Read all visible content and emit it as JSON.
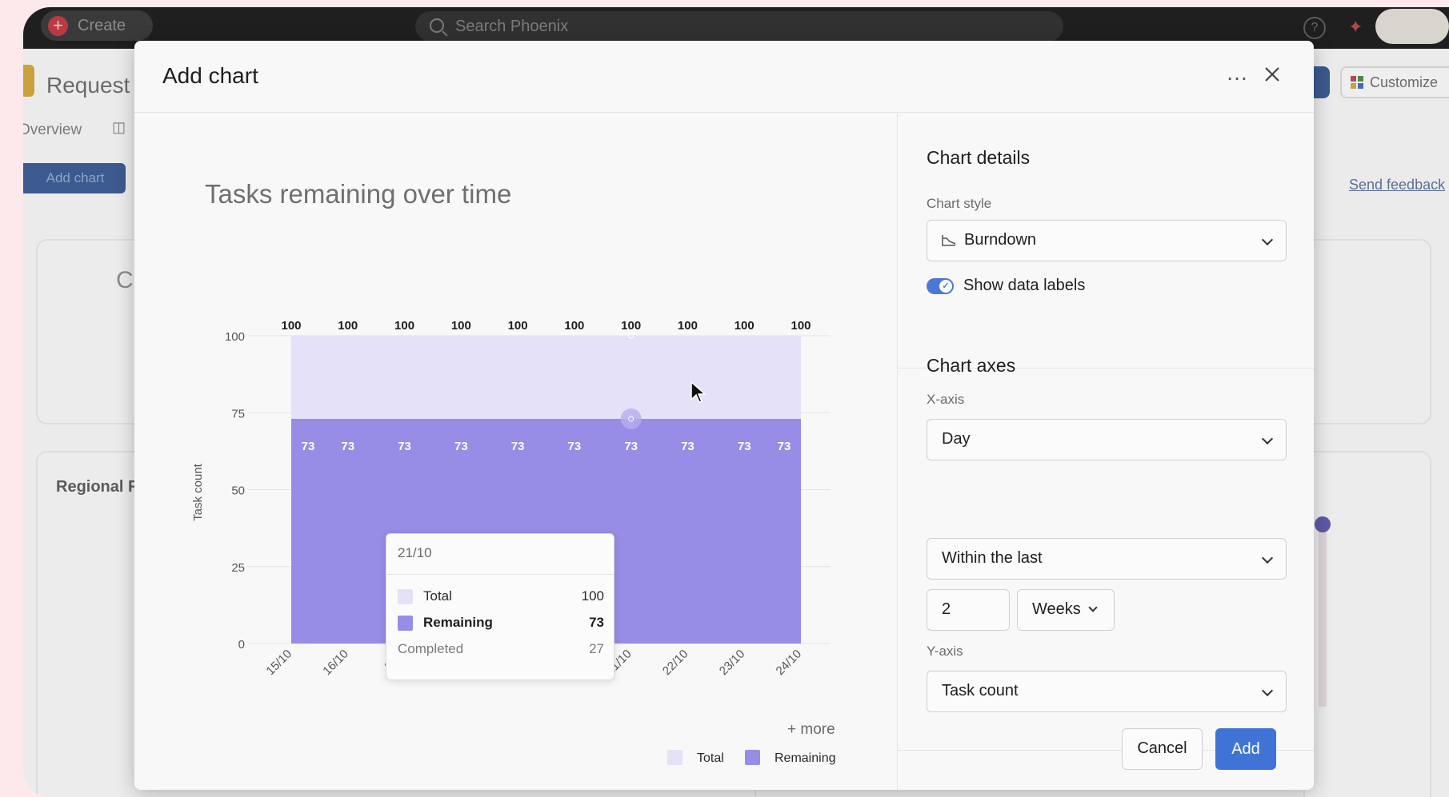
{
  "topbar": {
    "create_label": "Create",
    "search_placeholder": "Search Phoenix",
    "help_label": "?"
  },
  "project": {
    "title": "Request",
    "tab_overview": "Overview",
    "add_chart_label": "Add chart",
    "customize_label": "Customize",
    "send_feedback_label": "Send feedback",
    "card_letter": "C",
    "card_regional": "Regional R"
  },
  "modal": {
    "title": "Add chart",
    "more_label": "…",
    "chart": {
      "title": "Tasks remaining over time",
      "more_link": "+ more"
    },
    "tooltip": {
      "date": "21/10",
      "rows": [
        {
          "label": "Total",
          "value": "100",
          "color": "#e4e1f8"
        },
        {
          "label": "Remaining",
          "value": "73",
          "color": "#978ce6"
        },
        {
          "label": "Completed",
          "value": "27"
        }
      ]
    },
    "settings": {
      "chart_details_title": "Chart details",
      "chart_style_label": "Chart style",
      "chart_style_value": "Burndown",
      "show_data_labels": "Show data labels",
      "show_data_labels_on": true,
      "chart_axes_title": "Chart axes",
      "x_axis_label": "X-axis",
      "x_axis_value": "Day",
      "range_value": "Within the last",
      "range_number": "2",
      "range_unit": "Weeks",
      "y_axis_label": "Y-axis",
      "y_axis_value": "Task count"
    },
    "buttons": {
      "cancel": "Cancel",
      "add": "Add"
    }
  },
  "chart_data": {
    "type": "area",
    "title": "Tasks remaining over time",
    "xlabel": "",
    "ylabel": "Task count",
    "categories": [
      "15/10",
      "16/10",
      "17/10",
      "18/10",
      "19/10",
      "20/10",
      "21/10",
      "22/10",
      "23/10",
      "24/10"
    ],
    "visible_tick_labels": [
      "15/10",
      "16/10",
      "17/",
      "18/",
      "19/",
      "20/",
      "21/10",
      "22/10",
      "23/10",
      "24/10"
    ],
    "series": [
      {
        "name": "Total",
        "values": [
          100,
          100,
          100,
          100,
          100,
          100,
          100,
          100,
          100,
          100
        ],
        "color": "#e4e1f8"
      },
      {
        "name": "Remaining",
        "values": [
          73,
          73,
          73,
          73,
          73,
          73,
          73,
          73,
          73,
          73
        ],
        "color": "#978ce6"
      }
    ],
    "ylim": [
      0,
      100
    ],
    "yticks": [
      0,
      25,
      50,
      75,
      100
    ],
    "grid": true,
    "data_labels": true,
    "legend_position": "bottom-right"
  }
}
